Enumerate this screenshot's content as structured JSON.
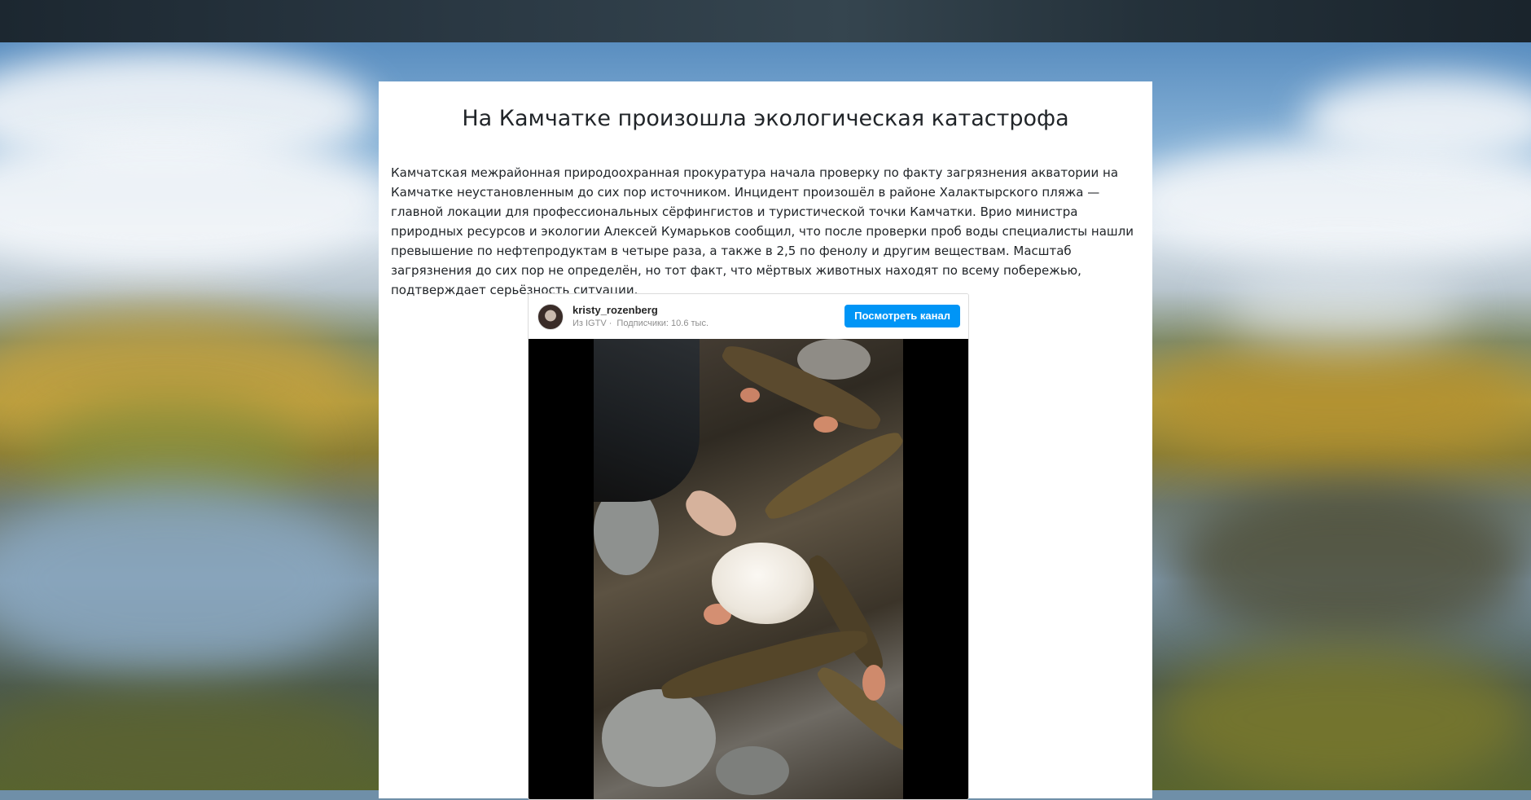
{
  "colors": {
    "accent_button": "#0095f6",
    "card_background": "#ffffff",
    "text": "#212529"
  },
  "article": {
    "title": "На Камчатке произошла экологическая катастрофа",
    "body": "Камчатская межрайонная природоохранная прокуратура начала проверку по факту загрязнения акватории на Камчатке неустановленным до сих пор источником. Инцидент произошёл в районе Халактырского пляжа — главной локации для профессиональных сёрфингистов и туристической точки Камчатки. Врио министра природных ресурсов и экологии Алексей Кумарьков сообщил, что после проверки проб воды специалисты нашли превышение по нефтепродуктам в четыре раза, а также в 2,5 по фенолу и другим веществам. Масштаб загрязнения до сих пор не определён, но тот факт, что мёртвых животных находят по всему побережью, подтверждает серьёзность ситуации."
  },
  "embed": {
    "username": "kristy_rozenberg",
    "source": "Из IGTV ·",
    "subscribers": "Подписчики: 10.6 тыс.",
    "view_channel_label": "Посмотреть канал"
  }
}
